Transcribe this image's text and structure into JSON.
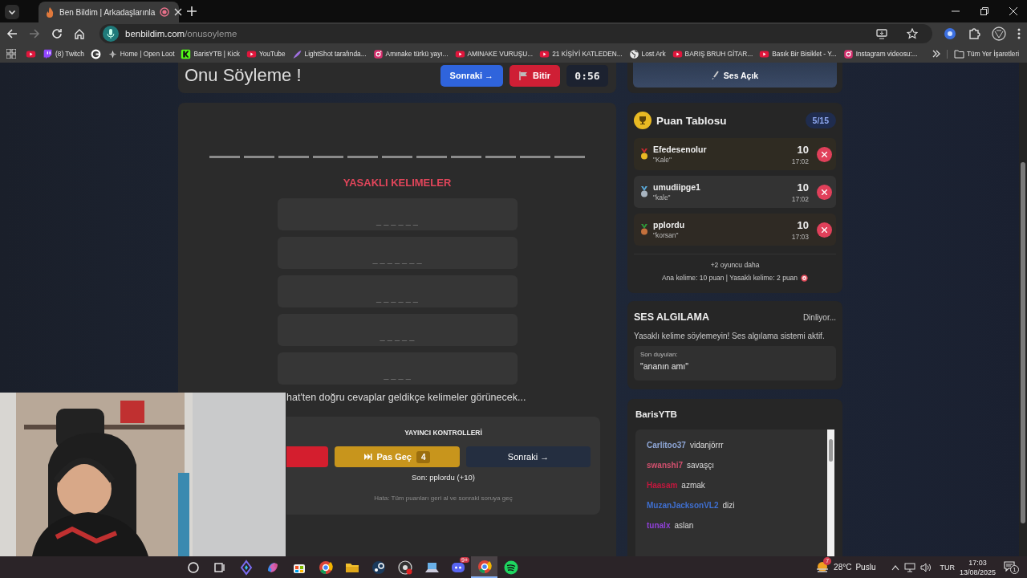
{
  "browser": {
    "tab": {
      "title": "Ben Bildim | Arkadaşlarınla",
      "recording": true
    },
    "url": {
      "host": "benbildim.com",
      "path": "/onusoyleme"
    },
    "bookmarks": [
      {
        "kind": "youtube"
      },
      {
        "kind": "twitch",
        "label": "(8) Twitch"
      },
      {
        "kind": "google"
      },
      {
        "kind": "openloot",
        "label": "Home | Open Loot"
      },
      {
        "kind": "kick",
        "label": "BarisYTB | Kick"
      },
      {
        "kind": "youtube",
        "label": "YouTube"
      },
      {
        "kind": "feather",
        "label": "LightShot tarafında..."
      },
      {
        "kind": "instagram",
        "label": "Amınake türkü yayı..."
      },
      {
        "kind": "youtube",
        "label": "AMINAKE VURUŞU..."
      },
      {
        "kind": "youtube",
        "label": "21 KİŞİYİ KATLEDEN..."
      },
      {
        "kind": "globe",
        "label": "Lost Ark"
      },
      {
        "kind": "youtube",
        "label": "BARIŞ BRUH GİTAR..."
      },
      {
        "kind": "youtube",
        "label": "Basık Bir Bisiklet - Y..."
      },
      {
        "kind": "instagram",
        "label": "Instagram videosu:..."
      }
    ],
    "all_bookmarks": "Tüm Yer İşaretleri"
  },
  "game": {
    "title": "Onu Söyleme !",
    "next_button": "Sonraki →",
    "finish_button": "Bitir",
    "timer": "0:56",
    "answer_blanks": [
      {
        "revealed": false
      },
      {
        "revealed": false
      },
      {
        "revealed": false
      },
      {
        "revealed": false
      },
      {
        "revealed": false
      },
      {
        "revealed": false
      },
      {
        "revealed": false
      },
      {
        "revealed": false
      },
      {
        "revealed": false
      },
      {
        "revealed": false
      },
      {
        "revealed": false
      }
    ],
    "forbidden_title": "YASAKLI KELIMELER",
    "forbidden_words": [
      {
        "mask": "_ _ _ _ _ _"
      },
      {
        "mask": "_ _ _ _ _ _ _"
      },
      {
        "mask": "_ _ _ _ _ _"
      },
      {
        "mask": "_ _ _ _ _"
      },
      {
        "mask": "_ _ _ _"
      }
    ],
    "hint": "hat'ten doğru cevaplar geldikçe kelimeler görünecek...",
    "controls": {
      "title": "YAYINCI KONTROLLERİ",
      "buttons": [
        {
          "kind": "danger"
        },
        {
          "kind": "pass",
          "label": "Pas Geç",
          "badge": "4"
        },
        {
          "kind": "next",
          "label": "Sonraki →"
        }
      ],
      "last": "Son: pplordu (+10)",
      "note": "Hata: Tüm puanları geri al ve sonraki soruya geç"
    }
  },
  "sidebar": {
    "sound_button": "Ses Açık",
    "leaderboard": {
      "title": "Puan Tablosu",
      "count": "5/15",
      "players": [
        {
          "kind": "gold",
          "name": "Efedesenolur",
          "answer": "\"Kale\"",
          "score": "10",
          "time": "17:02"
        },
        {
          "kind": "silver",
          "name": "umudiipge1",
          "answer": "\"kale\"",
          "score": "10",
          "time": "17:02"
        },
        {
          "kind": "bronze",
          "name": "pplordu",
          "answer": "\"korsan\"",
          "score": "10",
          "time": "17:03"
        }
      ],
      "more": "+2 oyuncu daha",
      "rules": "Ana kelime: 10 puan | Yasaklı kelime: 2 puan"
    },
    "voice": {
      "title": "SES ALGILAMA",
      "status": "Dinliyor...",
      "description": "Yasaklı kelime söylemeyin! Ses algılama sistemi aktif.",
      "last_label": "Son duyulan:",
      "last_heard": "\"ananın amı\""
    },
    "chat": {
      "title": "BarisYTB",
      "messages": [
        {
          "user": "Carlitoo37",
          "color": "#8ea6d6",
          "text": "vidanjörrr"
        },
        {
          "user": "swanshi7",
          "color": "#d2506e",
          "text": "savaşçı"
        },
        {
          "user": "Haasam",
          "color": "#c2183e",
          "text": "azmak"
        },
        {
          "user": "MuzanJacksonVL2",
          "color": "#3f6fd0",
          "text": "dizi"
        },
        {
          "user": "tunalx",
          "color": "#9040d8",
          "text": "aslan"
        }
      ]
    }
  },
  "taskbar": {
    "apps": [
      {
        "kind": "search",
        "active": false
      },
      {
        "kind": "taskview",
        "active": false
      },
      {
        "kind": "diamond",
        "active": false
      },
      {
        "kind": "swirl",
        "active": false
      },
      {
        "kind": "store",
        "active": false
      },
      {
        "kind": "browser",
        "active": false
      },
      {
        "kind": "folder",
        "active": false
      },
      {
        "kind": "steam",
        "active": false
      },
      {
        "kind": "record",
        "active": false
      },
      {
        "kind": "laptop",
        "active": false
      },
      {
        "kind": "chat",
        "active": false,
        "badge": "9+"
      },
      {
        "kind": "browser",
        "active": true
      },
      {
        "kind": "music",
        "active": false
      }
    ],
    "weather": {
      "temp": "28°C",
      "condition": "Puslu",
      "badge": "7"
    },
    "language": "TUR",
    "time": "17:03",
    "date": "13/08/2025",
    "notifications": "1"
  }
}
